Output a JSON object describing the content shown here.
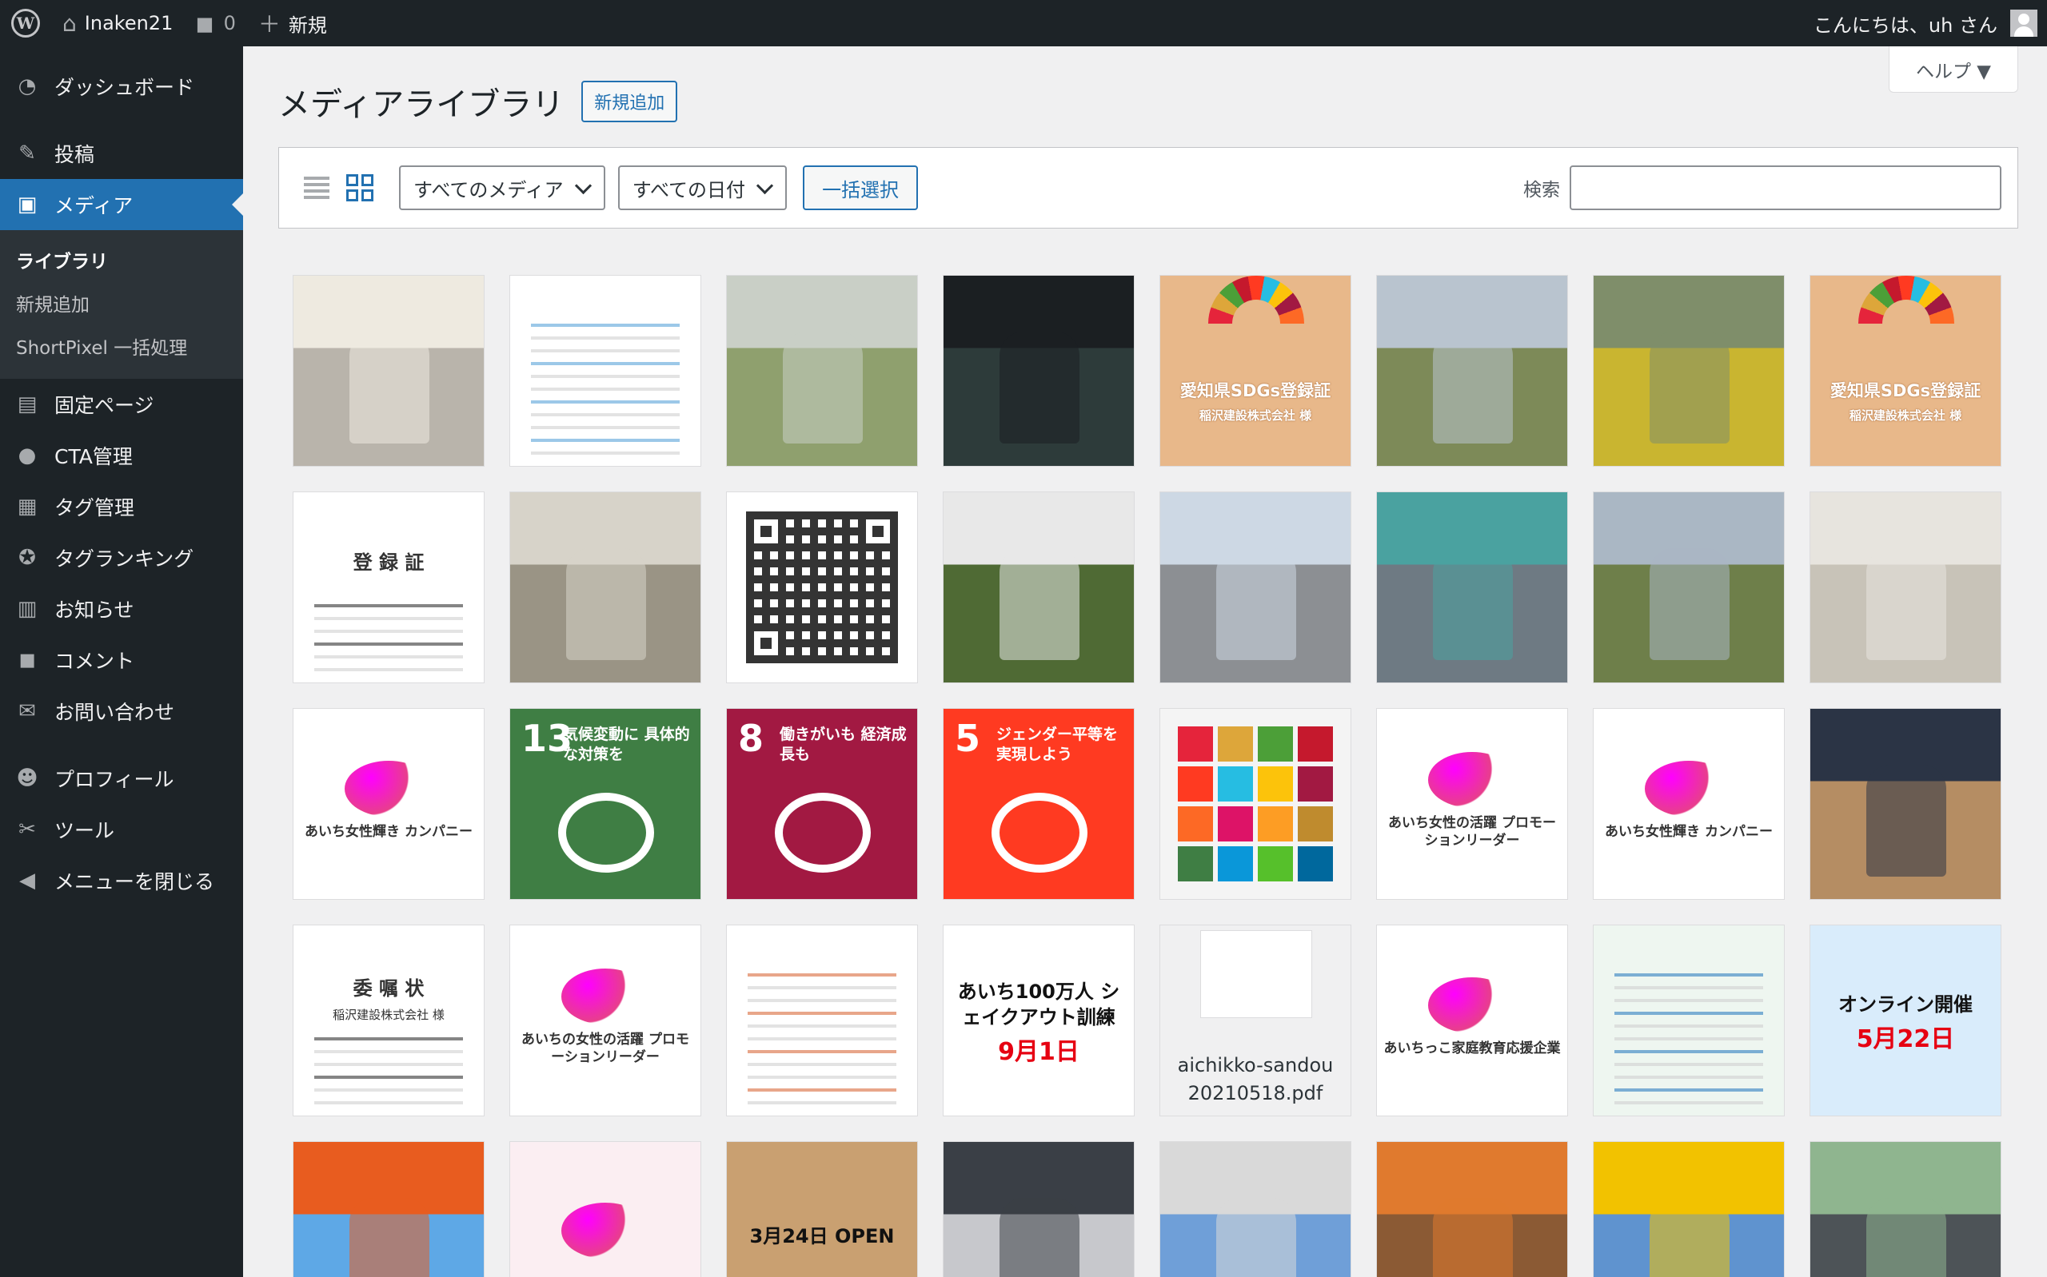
{
  "admin_bar": {
    "site_name": "Inaken21",
    "comment_count": "0",
    "new_label": "新規",
    "greeting": "こんにちは、uh さん"
  },
  "sidebar": {
    "items": [
      {
        "label": "ダッシュボード",
        "icon": "dashboard-icon",
        "glyph": "◔"
      },
      {
        "label": "投稿",
        "icon": "pin-icon",
        "glyph": "✎"
      },
      {
        "label": "メディア",
        "icon": "media-icon",
        "glyph": "▣"
      },
      {
        "label": "固定ページ",
        "icon": "page-icon",
        "glyph": "▤"
      },
      {
        "label": "CTA管理",
        "icon": "lightbulb-icon",
        "glyph": "●"
      },
      {
        "label": "タグ管理",
        "icon": "tag-layout-icon",
        "glyph": "▦"
      },
      {
        "label": "タグランキング",
        "icon": "award-icon",
        "glyph": "✪"
      },
      {
        "label": "お知らせ",
        "icon": "book-icon",
        "glyph": "▥"
      },
      {
        "label": "コメント",
        "icon": "comment-icon",
        "glyph": "◼"
      },
      {
        "label": "お問い合わせ",
        "icon": "mail-icon",
        "glyph": "✉"
      },
      {
        "label": "プロフィール",
        "icon": "user-icon",
        "glyph": "☻"
      },
      {
        "label": "ツール",
        "icon": "wrench-icon",
        "glyph": "✂"
      },
      {
        "label": "メニューを閉じる",
        "icon": "collapse-icon",
        "glyph": "◀"
      }
    ],
    "submenu": [
      "ライブラリ",
      "新規追加",
      "ShortPixel 一括処理"
    ]
  },
  "header": {
    "title": "メディアライブラリ",
    "add_new": "新規追加",
    "help": "ヘルプ ▼"
  },
  "toolbar": {
    "media_filter": "すべてのメディア",
    "date_filter": "すべての日付",
    "bulk_select": "一括選択",
    "search_label": "検索",
    "search_value": ""
  },
  "media_tiles": [
    {
      "kind": "photo",
      "name": "certificate-man-photo",
      "bg": "#b9b4ab",
      "fg": "#eeeae0"
    },
    {
      "kind": "doc",
      "name": "health-certificate-doc",
      "bg": "#ffffff",
      "fg": "#5aa3d8"
    },
    {
      "kind": "photo",
      "name": "road-workers-photo",
      "bg": "#8fa06e",
      "fg": "#c9cfc6"
    },
    {
      "kind": "photo",
      "name": "phone-device-photo",
      "bg": "#2d3b3a",
      "fg": "#1b1f22"
    },
    {
      "kind": "sdgs",
      "name": "sdgs-registration-wood-1",
      "bg": "#e8b88a",
      "text": "愛知県SDGs登録証",
      "sub": "稲沢建設株式会社 様"
    },
    {
      "kind": "photo",
      "name": "rural-road-sign-photo",
      "bg": "#7d8a58",
      "fg": "#b9c4cf"
    },
    {
      "kind": "photo",
      "name": "yellow-machine-photo",
      "bg": "#c9b530",
      "fg": "#7f8e6a"
    },
    {
      "kind": "sdgs",
      "name": "sdgs-registration-wood-2",
      "bg": "#e8b88a",
      "text": "愛知県SDGs登録証",
      "sub": "稲沢建設株式会社 様"
    },
    {
      "kind": "doc",
      "name": "registration-certificate-doc",
      "bg": "#ffffff",
      "text": "登 録 証",
      "fg": "#333333"
    },
    {
      "kind": "photo",
      "name": "roadside-cleanup-photo",
      "bg": "#9a9485",
      "fg": "#d7d3c9"
    },
    {
      "kind": "qr",
      "name": "qr-code-image",
      "bg": "#ffffff"
    },
    {
      "kind": "photo",
      "name": "fence-sign-photo",
      "bg": "#4f6a34",
      "fg": "#e8e8e8"
    },
    {
      "kind": "photo",
      "name": "straight-road-photo",
      "bg": "#8c8f93",
      "fg": "#cdd8e4"
    },
    {
      "kind": "photo",
      "name": "excavator-photo",
      "bg": "#6e7a83",
      "fg": "#4aa2a0"
    },
    {
      "kind": "photo",
      "name": "canal-bridge-photo",
      "bg": "#6e7f4a",
      "fg": "#aab7c4"
    },
    {
      "kind": "photo",
      "name": "office-staff-photo",
      "bg": "#c8c3b8",
      "fg": "#e7e4de"
    },
    {
      "kind": "logo",
      "name": "aichi-women-company-cert",
      "bg": "#ffffff",
      "text": "あいち女性輝き カンパニー"
    },
    {
      "kind": "sdg",
      "name": "sdg-13-icon",
      "bg": "#3f7e44",
      "num": "13",
      "text": "気候変動に 具体的な対策を"
    },
    {
      "kind": "sdg",
      "name": "sdg-8-icon",
      "bg": "#a21942",
      "num": "8",
      "text": "働きがいも 経済成長も"
    },
    {
      "kind": "sdg",
      "name": "sdg-5-icon",
      "bg": "#ff3a21",
      "num": "5",
      "text": "ジェンダー平等を 実現しよう"
    },
    {
      "kind": "sdggrid",
      "name": "sdgs-grid-icons",
      "bg": "#f4f4f4"
    },
    {
      "kind": "logo",
      "name": "aichi-women-leader-logo",
      "bg": "#ffffff",
      "text": "あいち女性の活躍 プロモーションリーダー"
    },
    {
      "kind": "logo",
      "name": "aichi-women-company-cert-2",
      "bg": "#ffffff",
      "text": "あいち女性輝き カンパニー"
    },
    {
      "kind": "photo",
      "name": "award-ceremony-photo",
      "bg": "#b58d63",
      "fg": "#2b3445"
    },
    {
      "kind": "doc",
      "name": "commission-letter-doc",
      "bg": "#ffffff",
      "text": "委 嘱 状",
      "sub": "稲沢建設株式会社 様",
      "fg": "#333333"
    },
    {
      "kind": "logo",
      "name": "aichi-women-leader-logo-2",
      "bg": "#ffffff",
      "text": "あいちの女性の活躍 プロモーションリーダー"
    },
    {
      "kind": "doc",
      "name": "flyer-document",
      "bg": "#ffffff",
      "fg": "#d96b3c"
    },
    {
      "kind": "poster",
      "name": "shakeout-poster",
      "bg": "#ffffff",
      "text": "あいち100万人 シェイクアウト訓練",
      "sub": "9月1日"
    },
    {
      "kind": "pdf",
      "name": "pdf-file-tile",
      "bg": "#f0f0f1",
      "filename": "aichikko-sandou20210518.pdf"
    },
    {
      "kind": "logo",
      "name": "aichi-family-education-logo",
      "bg": "#ffffff",
      "text": "あいちっこ家庭教育応援企業"
    },
    {
      "kind": "doc",
      "name": "charity-flyer-doc",
      "bg": "#eef6f0",
      "fg": "#2f7fbf"
    },
    {
      "kind": "poster",
      "name": "online-event-poster",
      "bg": "#d9ecfb",
      "text": "オンライン開催",
      "sub": "5月22日"
    },
    {
      "kind": "photo",
      "name": "store-building-photo",
      "bg": "#5ea8e6",
      "fg": "#e85c1f"
    },
    {
      "kind": "logo",
      "name": "child-illustration-doc",
      "bg": "#fbeef2",
      "text": ""
    },
    {
      "kind": "poster",
      "name": "open-dog-poster",
      "bg": "#c9a071",
      "text": "3月24日 OPEN",
      "sub": ""
    },
    {
      "kind": "photo",
      "name": "reception-device-photo",
      "bg": "#c7c8cc",
      "fg": "#3a3f46"
    },
    {
      "kind": "photo",
      "name": "office-building-photo",
      "bg": "#6f9fd8",
      "fg": "#d9d9d9"
    },
    {
      "kind": "photo",
      "name": "tunnel-shaft-photo",
      "bg": "#8b5a34",
      "fg": "#e07a2e"
    },
    {
      "kind": "photo",
      "name": "crane-site-photo",
      "bg": "#5f93cf",
      "fg": "#f2c200"
    },
    {
      "kind": "photo",
      "name": "pipe-tunnel-photo",
      "bg": "#4d5357",
      "fg": "#8fb58f"
    }
  ]
}
